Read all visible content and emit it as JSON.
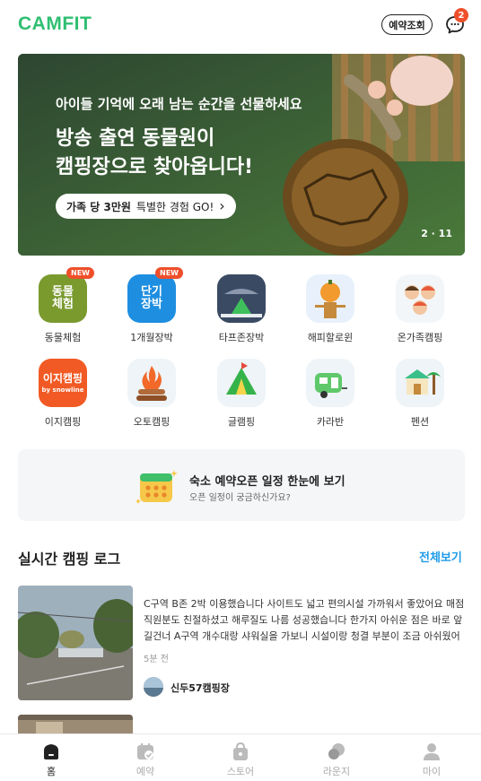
{
  "header": {
    "logo": "CAMFIT",
    "reserve_button": "예약조회",
    "chat_badge": "2"
  },
  "banner": {
    "subtitle": "아이들 기억에 오래 남는 순간을 선물하세요",
    "title_line1": "방송 출연 동물원이",
    "title_line2": "캠핑장으로 찾아옵니다!",
    "cta_bold": "가족 당 3만원",
    "cta_rest": "특별한 경험 GO!",
    "cta_arrow": "›",
    "page_indicator": "2 · 11"
  },
  "categories": [
    {
      "label": "동물체험",
      "icon": "animal-experience-icon",
      "icon_text": "동물\n체험",
      "badge": "NEW"
    },
    {
      "label": "1개월장박",
      "icon": "long-stay-icon",
      "icon_text": "단기\n장박",
      "badge": "NEW"
    },
    {
      "label": "타프존장박",
      "icon": "tarp-zone-icon",
      "icon_text": "",
      "badge": ""
    },
    {
      "label": "해피할로윈",
      "icon": "halloween-icon",
      "icon_text": "",
      "badge": ""
    },
    {
      "label": "온가족캠핑",
      "icon": "family-camping-icon",
      "icon_text": "",
      "badge": ""
    },
    {
      "label": "이지캠핑",
      "icon": "easy-camping-icon",
      "icon_text": "이지캠핑",
      "icon_subtext": "by snowline",
      "badge": ""
    },
    {
      "label": "오토캠핑",
      "icon": "auto-camping-icon",
      "icon_text": "",
      "badge": ""
    },
    {
      "label": "글램핑",
      "icon": "glamping-icon",
      "icon_text": "",
      "badge": ""
    },
    {
      "label": "카라반",
      "icon": "caravan-icon",
      "icon_text": "",
      "badge": ""
    },
    {
      "label": "펜션",
      "icon": "pension-icon",
      "icon_text": "",
      "badge": ""
    }
  ],
  "schedule": {
    "title": "숙소 예약오픈 일정 한눈에 보기",
    "subtitle": "오픈 일정이 궁금하신가요?"
  },
  "log_section": {
    "title": "실시간 캠핑 로그",
    "see_all": "전체보기",
    "items": [
      {
        "text": "C구역 B존 2박 이용했습니다 사이트도 넓고 편의시설 가까워서 좋았어요 매점 직원분도 친절하셨고 해루질도 나름 성공했습니다 한가지 아쉬운 점은 바로 앞 길건너 A구역 개수대랑 샤워실을 가보니 시설이랑 청결 부분이 조금 아쉬웠어요",
        "time": "5분 전",
        "author": "신두57캠핑장"
      }
    ]
  },
  "tabbar": {
    "tabs": [
      {
        "label": "홈",
        "icon": "home-icon",
        "active": true
      },
      {
        "label": "예약",
        "icon": "calendar-check-icon",
        "active": false
      },
      {
        "label": "스토어",
        "icon": "shopping-bag-icon",
        "active": false
      },
      {
        "label": "라운지",
        "icon": "lounge-icon",
        "active": false
      },
      {
        "label": "마이",
        "icon": "person-icon",
        "active": false
      }
    ]
  },
  "colors": {
    "brand": "#2fbf71",
    "badge": "#ef4f2b",
    "link": "#1e9be8"
  }
}
